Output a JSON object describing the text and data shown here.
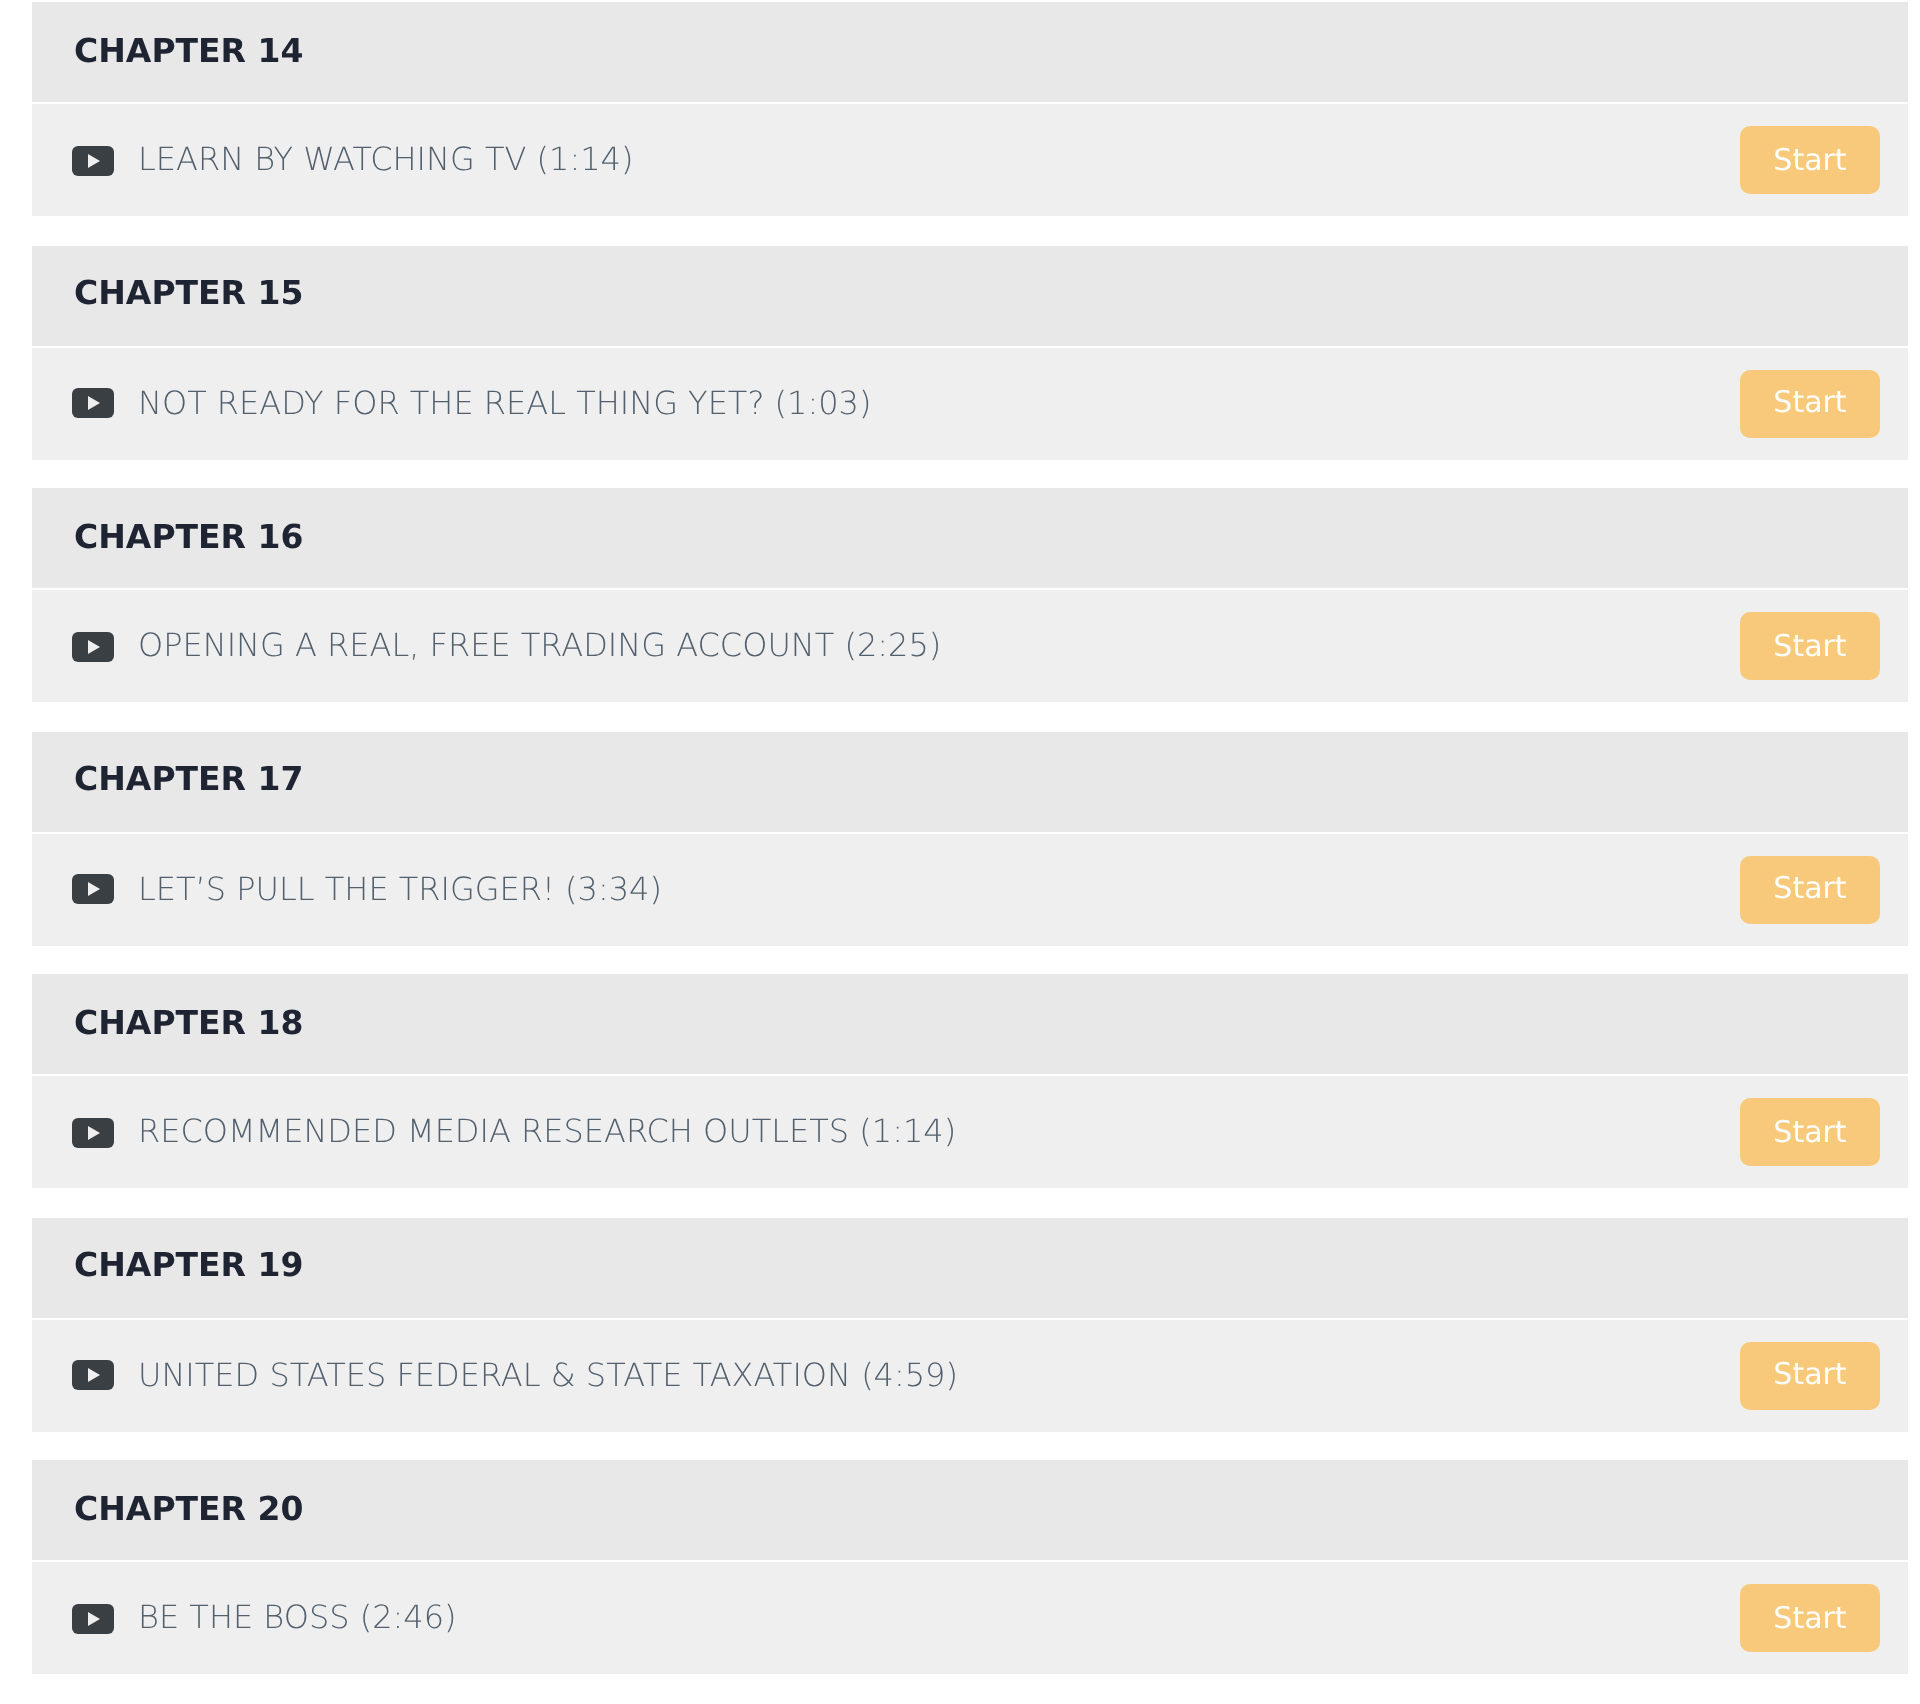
{
  "chapters": [
    {
      "title": "CHAPTER 14",
      "lesson": "LEARN BY WATCHING TV (1:14)",
      "button": "Start"
    },
    {
      "title": "CHAPTER 15",
      "lesson": "NOT READY FOR THE REAL THING YET? (1:03)",
      "button": "Start"
    },
    {
      "title": "CHAPTER 16",
      "lesson": "OPENING A REAL, FREE TRADING ACCOUNT (2:25)",
      "button": "Start"
    },
    {
      "title": "CHAPTER 17",
      "lesson": "LET’S PULL THE TRIGGER! (3:34)",
      "button": "Start"
    },
    {
      "title": "CHAPTER 18",
      "lesson": "RECOMMENDED MEDIA RESEARCH OUTLETS (1:14)",
      "button": "Start"
    },
    {
      "title": "CHAPTER 19",
      "lesson": "UNITED STATES FEDERAL & STATE TAXATION (4:59)",
      "button": "Start"
    },
    {
      "title": "CHAPTER 20",
      "lesson": "BE THE BOSS (2:46)",
      "button": "Start"
    }
  ]
}
